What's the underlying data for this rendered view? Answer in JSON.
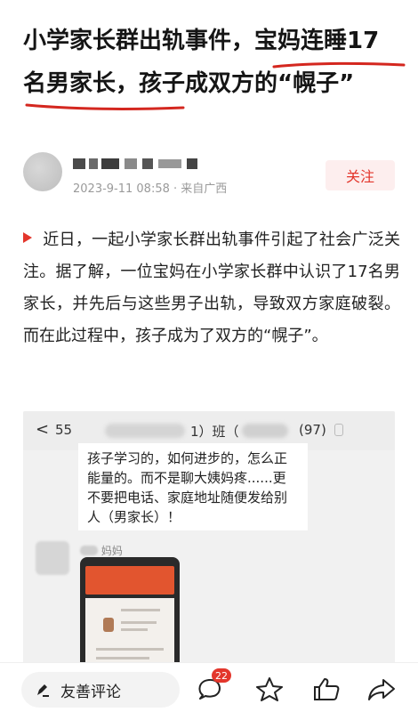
{
  "article": {
    "title_part1": "小学家长群出轨事件，",
    "title_part2": "宝妈连睡17名男家长",
    "title_part3": "，孩子成双方的“幌子”",
    "author_name": "",
    "date": "2023-9-11 08:58",
    "location": "来自广西",
    "follow_label": "关注",
    "body": "近日，一起小学家长群出轨事件引起了社会广泛关注。据了解，一位宝妈在小学家长群中认识了17名男家长，并先后与这些男子出轨，导致双方家庭破裂。而在此过程中，孩子成为了双方的“幌子”。"
  },
  "embed": {
    "back_symbol": "<",
    "unread_count": "55",
    "group_suffix": "1）班（",
    "member_count": "(97)",
    "message_text": "孩子学习的，如何进步的，怎么正能量的。而不是聊大姨妈疼......更不要把电话、家庭地址随便发给别人（男家长）！",
    "sender_suffix": "妈妈"
  },
  "bottom": {
    "comment_placeholder": "友善评论",
    "comment_count_badge": "22",
    "icons": [
      "comment-icon",
      "star-icon",
      "like-icon",
      "share-icon"
    ]
  },
  "colors": {
    "accent": "#e3362c",
    "underline": "#d4271f",
    "follow_bg": "#fdeeee"
  }
}
